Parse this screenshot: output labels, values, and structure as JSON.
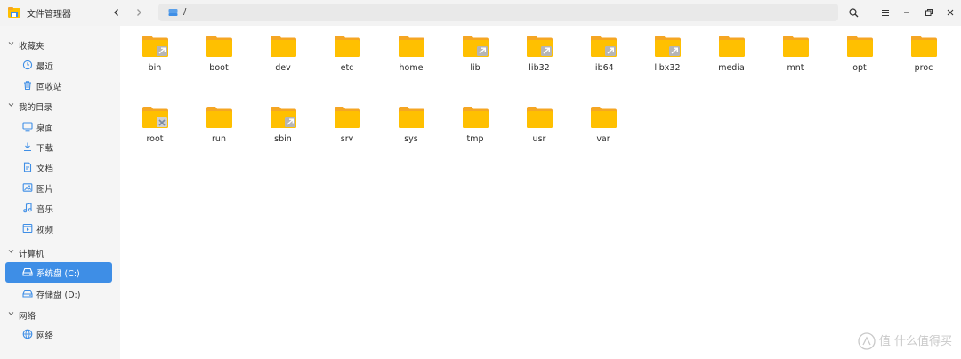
{
  "app": {
    "title": "文件管理器"
  },
  "address": {
    "path": "/"
  },
  "sidebar": {
    "groups": [
      {
        "label": "收藏夹",
        "items": [
          {
            "label": "最近",
            "icon": "clock-icon"
          },
          {
            "label": "回收站",
            "icon": "trash-icon"
          }
        ]
      },
      {
        "label": "我的目录",
        "items": [
          {
            "label": "桌面",
            "icon": "desktop-icon"
          },
          {
            "label": "下载",
            "icon": "download-icon"
          },
          {
            "label": "文档",
            "icon": "document-icon"
          },
          {
            "label": "图片",
            "icon": "image-icon"
          },
          {
            "label": "音乐",
            "icon": "music-icon"
          },
          {
            "label": "视频",
            "icon": "video-icon"
          }
        ]
      },
      {
        "label": "计算机",
        "items": [
          {
            "label": "系统盘 (C:)",
            "icon": "drive-icon",
            "active": true
          },
          {
            "label": "存储盘 (D:)",
            "icon": "drive-icon"
          }
        ]
      },
      {
        "label": "网络",
        "items": [
          {
            "label": "网络",
            "icon": "network-icon"
          }
        ]
      }
    ]
  },
  "files": [
    {
      "name": "bin",
      "badge": "link"
    },
    {
      "name": "boot"
    },
    {
      "name": "dev"
    },
    {
      "name": "etc"
    },
    {
      "name": "home"
    },
    {
      "name": "lib",
      "badge": "link"
    },
    {
      "name": "lib32",
      "badge": "link"
    },
    {
      "name": "lib64",
      "badge": "link"
    },
    {
      "name": "libx32",
      "badge": "link"
    },
    {
      "name": "media"
    },
    {
      "name": "mnt"
    },
    {
      "name": "opt"
    },
    {
      "name": "proc"
    },
    {
      "name": "root",
      "badge": "locked"
    },
    {
      "name": "run"
    },
    {
      "name": "sbin",
      "badge": "link"
    },
    {
      "name": "srv"
    },
    {
      "name": "sys"
    },
    {
      "name": "tmp"
    },
    {
      "name": "usr"
    },
    {
      "name": "var"
    }
  ],
  "watermark": {
    "text": "值 什么值得买"
  },
  "colors": {
    "accent": "#3e8ee6",
    "folder": "#ffc000",
    "folder_tab": "#f5a623"
  }
}
